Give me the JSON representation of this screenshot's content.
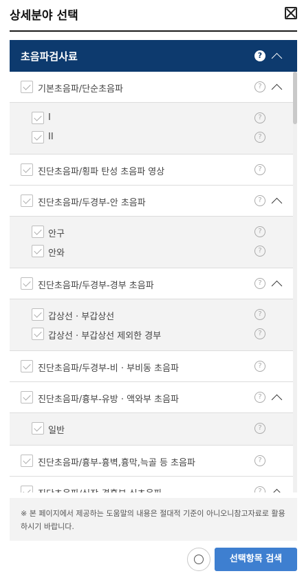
{
  "header": {
    "title": "상세분야 선택"
  },
  "section": {
    "label": "초음파검사료",
    "help": "?"
  },
  "groups": [
    {
      "label": "기본초음파/단순초음파",
      "expanded": true,
      "children": [
        "I",
        "II"
      ]
    },
    {
      "label": "진단초음파/횡파 탄성 초음파 영상",
      "expanded": false,
      "children": []
    },
    {
      "label": "진단초음파/두경부-안 초음파",
      "expanded": true,
      "children": [
        "안구",
        "안와"
      ]
    },
    {
      "label": "진단초음파/두경부-경부 초음파",
      "expanded": true,
      "children": [
        "갑상선 · 부갑상선",
        "갑상선 · 부갑상선 제외한 경부"
      ]
    },
    {
      "label": "진단초음파/두경부-비 · 부비동 초음파",
      "expanded": false,
      "children": []
    },
    {
      "label": "진단초음파/흉부-유방 · 액와부 초음파",
      "expanded": true,
      "children": [
        "일반"
      ]
    },
    {
      "label": "진단초음파/흉부-흉벽,흉막,늑골 등 초음파",
      "expanded": false,
      "children": []
    },
    {
      "label": "진단초음파/심장-경흉부 심초음파",
      "expanded": true,
      "children": []
    }
  ],
  "help_symbol": "?",
  "notice": "※ 본 페이지에서 제공하는 도움말의 내용은 절대적 기준이 아니오니참고자료로 활용하시기 바랍니다.",
  "buttons": {
    "search_label": "선택항목 검색"
  },
  "colors": {
    "section_bg": "#0d3a6e",
    "search_btn": "#3e7fd0"
  }
}
